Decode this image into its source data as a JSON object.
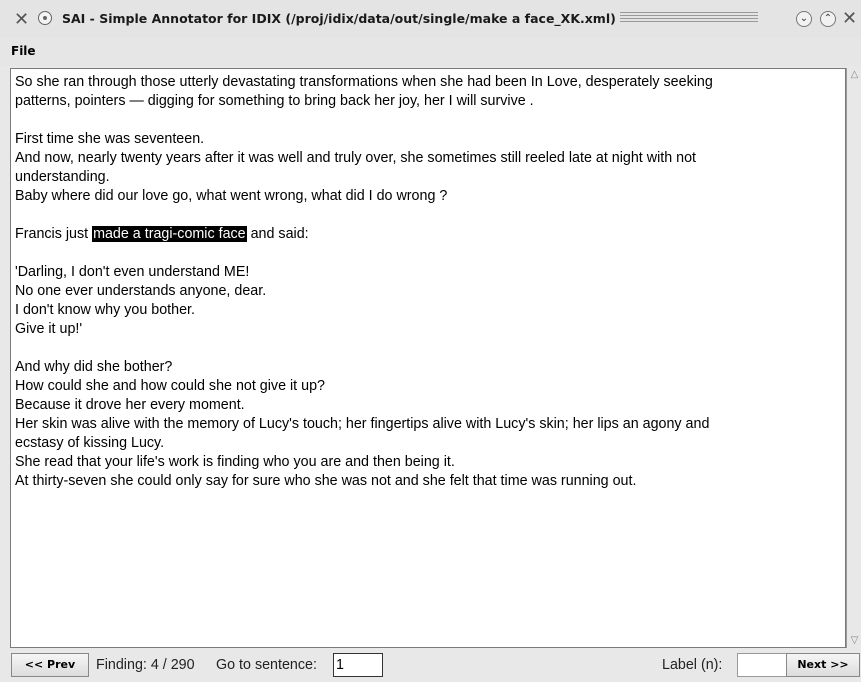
{
  "window": {
    "title": "SAI - Simple Annotator for IDIX (/proj/idix/data/out/single/make a face_XK.xml)",
    "icons": {
      "app": "x-tools-icon",
      "sticky": "sticky-dot-icon",
      "minimize": "chevron-down-icon",
      "maximize": "chevron-up-icon",
      "close": "close-icon"
    }
  },
  "menubar": {
    "file": "File"
  },
  "document": {
    "p1": [
      "So she ran through those utterly devastating transformations when she had been In Love, desperately seeking",
      "patterns, pointers — digging for something to bring back her joy, her I will survive ."
    ],
    "p2": [
      "First time she was seventeen.",
      "And now, nearly twenty years after it was well and truly over, she sometimes still reeled late at night with not",
      "understanding.",
      "Baby where did our love go, what went wrong, what did I do wrong ?"
    ],
    "p3": {
      "before": "Francis just ",
      "highlight": "made a tragi-comic face",
      "after": " and said:"
    },
    "p4": [
      "'Darling, I don't even understand ME!",
      "No one ever understands anyone, dear.",
      "I don't know why you bother.",
      "Give it up!'"
    ],
    "p5": [
      "And why did she bother?",
      "How could she and how could she not give it up?",
      "Because it drove her every moment.",
      "Her skin was alive with the memory of Lucy's touch; her fingertips alive with Lucy's skin; her lips an agony and",
      "ecstasy of kissing Lucy.",
      "She read that your life's work is finding who you are and then being it.",
      "At thirty-seven she could only say for sure who she was not and she felt that time was running out."
    ]
  },
  "bottom": {
    "prev": "<< Prev",
    "finding": "Finding: 4 / 290",
    "goto_label": "Go to sentence:",
    "goto_value": "1",
    "label_n": "Label (n):",
    "label_value": "",
    "next": "Next >>"
  },
  "colors": {
    "highlight_bg": "#000000",
    "highlight_fg": "#ffffff"
  }
}
